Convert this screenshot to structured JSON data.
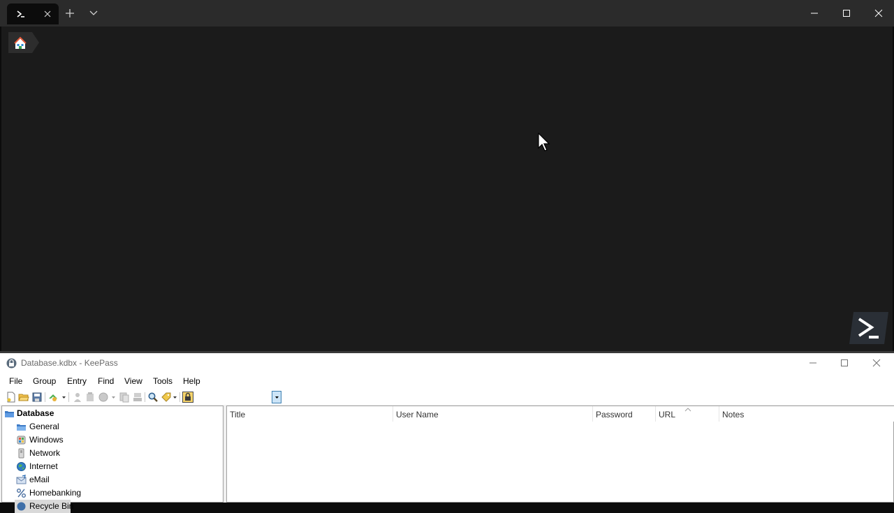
{
  "terminal": {
    "tab_icon": "powershell-icon",
    "close_tab_icon": "close-icon",
    "new_tab_icon": "plus-icon",
    "dropdown_icon": "chevron-down-icon",
    "window_controls": [
      "minimize-icon",
      "maximize-icon",
      "close-icon"
    ],
    "home_icon": "home-icon",
    "logo_icon": "powershell-prompt-icon"
  },
  "keepass": {
    "title": "Database.kdbx - KeePass",
    "menu": [
      "File",
      "Group",
      "Entry",
      "Find",
      "View",
      "Tools",
      "Help"
    ],
    "toolbar_icons": [
      "new-database-icon",
      "open-database-icon",
      "save-icon",
      "sync-icon",
      "copy-username-icon",
      "copy-password-icon",
      "open-url-icon",
      "autotype-icon",
      "copy-entry-icon",
      "find-icon",
      "tag-icon",
      "lock-workspace-icon"
    ],
    "tree": {
      "root": "Database",
      "groups": [
        "General",
        "Windows",
        "Network",
        "Internet",
        "eMail",
        "Homebanking",
        "Recycle Bin"
      ]
    },
    "columns": [
      "Title",
      "User Name",
      "Password",
      "URL",
      "Notes"
    ],
    "sorted_column": "URL"
  },
  "colors": {
    "terminal_bg": "#1b1b1b",
    "terminal_titlebar": "#2b2b2b",
    "keepass_bg": "#f0f0f0",
    "selection_accent": "#3c7fb1"
  }
}
